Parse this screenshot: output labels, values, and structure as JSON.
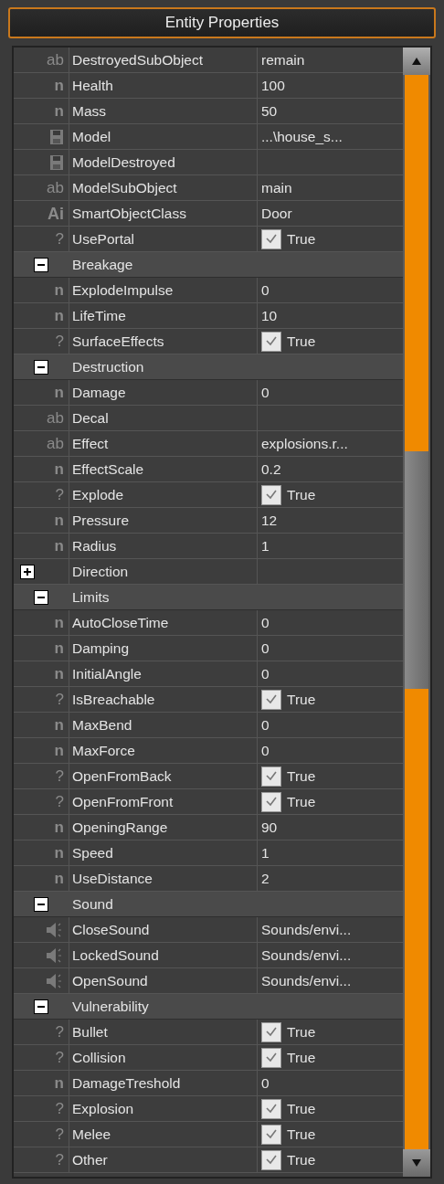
{
  "panel": {
    "title": "Entity Properties"
  },
  "rows": [
    {
      "kind": "string",
      "symbol": "ab",
      "name": "DestroyedSubObject",
      "value": "remain"
    },
    {
      "kind": "number",
      "symbol": "n",
      "name": "Health",
      "value": "100"
    },
    {
      "kind": "number",
      "symbol": "n",
      "name": "Mass",
      "value": "50"
    },
    {
      "kind": "file",
      "name": "Model",
      "value": "...\\house_s..."
    },
    {
      "kind": "file",
      "name": "ModelDestroyed"
    },
    {
      "kind": "string",
      "symbol": "ab",
      "name": "ModelSubObject",
      "value": "main"
    },
    {
      "kind": "class",
      "symbol": "Ai",
      "name": "SmartObjectClass",
      "value": "Door"
    },
    {
      "kind": "bool",
      "symbol": "?",
      "name": "UsePortal",
      "checked": true,
      "value": "True"
    },
    {
      "kind": "group",
      "name": "Breakage",
      "expanded": true,
      "children": [
        {
          "kind": "number",
          "symbol": "n",
          "name": "ExplodeImpulse",
          "value": "0"
        },
        {
          "kind": "number",
          "symbol": "n",
          "name": "LifeTime",
          "value": "10"
        },
        {
          "kind": "bool",
          "symbol": "?",
          "name": "SurfaceEffects",
          "checked": true,
          "value": "True"
        }
      ]
    },
    {
      "kind": "group",
      "name": "Destruction",
      "expanded": true,
      "children": [
        {
          "kind": "number",
          "symbol": "n",
          "name": "Damage",
          "value": "0"
        },
        {
          "kind": "string",
          "symbol": "ab",
          "name": "Decal"
        },
        {
          "kind": "string",
          "symbol": "ab",
          "name": "Effect",
          "value": "explosions.r..."
        },
        {
          "kind": "number",
          "symbol": "n",
          "name": "EffectScale",
          "value": "0.2"
        },
        {
          "kind": "bool",
          "symbol": "?",
          "name": "Explode",
          "checked": true,
          "value": "True"
        },
        {
          "kind": "number",
          "symbol": "n",
          "name": "Pressure",
          "value": "12"
        },
        {
          "kind": "number",
          "symbol": "n",
          "name": "Radius",
          "value": "1"
        },
        {
          "kind": "group",
          "name": "Direction",
          "expanded": false
        }
      ]
    },
    {
      "kind": "group",
      "name": "Limits",
      "expanded": true,
      "children": [
        {
          "kind": "number",
          "symbol": "n",
          "name": "AutoCloseTime",
          "value": "0"
        },
        {
          "kind": "number",
          "symbol": "n",
          "name": "Damping",
          "value": "0"
        },
        {
          "kind": "number",
          "symbol": "n",
          "name": "InitialAngle",
          "value": "0"
        },
        {
          "kind": "bool",
          "symbol": "?",
          "name": "IsBreachable",
          "checked": true,
          "value": "True"
        },
        {
          "kind": "number",
          "symbol": "n",
          "name": "MaxBend",
          "value": "0"
        },
        {
          "kind": "number",
          "symbol": "n",
          "name": "MaxForce",
          "value": "0"
        },
        {
          "kind": "bool",
          "symbol": "?",
          "name": "OpenFromBack",
          "checked": true,
          "value": "True"
        },
        {
          "kind": "bool",
          "symbol": "?",
          "name": "OpenFromFront",
          "checked": true,
          "value": "True"
        },
        {
          "kind": "number",
          "symbol": "n",
          "name": "OpeningRange",
          "value": "90"
        },
        {
          "kind": "number",
          "symbol": "n",
          "name": "Speed",
          "value": "1"
        },
        {
          "kind": "number",
          "symbol": "n",
          "name": "UseDistance",
          "value": "2"
        }
      ]
    },
    {
      "kind": "group",
      "name": "Sound",
      "expanded": true,
      "children": [
        {
          "kind": "sound",
          "name": "CloseSound",
          "value": "Sounds/envi..."
        },
        {
          "kind": "sound",
          "name": "LockedSound",
          "value": "Sounds/envi..."
        },
        {
          "kind": "sound",
          "name": "OpenSound",
          "value": "Sounds/envi..."
        }
      ]
    },
    {
      "kind": "group",
      "name": "Vulnerability",
      "expanded": true,
      "children": [
        {
          "kind": "bool",
          "symbol": "?",
          "name": "Bullet",
          "checked": true,
          "value": "True"
        },
        {
          "kind": "bool",
          "symbol": "?",
          "name": "Collision",
          "checked": true,
          "value": "True"
        },
        {
          "kind": "number",
          "symbol": "n",
          "name": "DamageTreshold",
          "value": "0"
        },
        {
          "kind": "bool",
          "symbol": "?",
          "name": "Explosion",
          "checked": true,
          "value": "True"
        },
        {
          "kind": "bool",
          "symbol": "?",
          "name": "Melee",
          "checked": true,
          "value": "True"
        },
        {
          "kind": "bool",
          "symbol": "?",
          "name": "Other",
          "checked": true,
          "value": "True"
        }
      ]
    }
  ]
}
